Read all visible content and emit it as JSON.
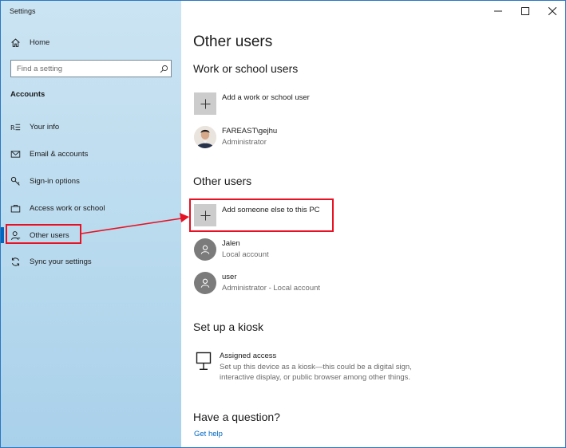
{
  "window": {
    "title": "Settings"
  },
  "sidebar": {
    "home_label": "Home",
    "search_placeholder": "Find a setting",
    "section_label": "Accounts",
    "items": [
      {
        "label": "Your info",
        "icon": "your-info-icon"
      },
      {
        "label": "Email & accounts",
        "icon": "email-icon"
      },
      {
        "label": "Sign-in options",
        "icon": "key-icon"
      },
      {
        "label": "Access work or school",
        "icon": "briefcase-icon"
      },
      {
        "label": "Other users",
        "icon": "person-icon",
        "selected": true
      },
      {
        "label": "Sync your settings",
        "icon": "sync-icon"
      }
    ]
  },
  "main": {
    "title": "Other users",
    "work_school": {
      "heading": "Work or school users",
      "add_label": "Add a work or school user",
      "user": {
        "name": "FAREAST\\gejhu",
        "role": "Administrator"
      }
    },
    "other_users": {
      "heading": "Other users",
      "add_label": "Add someone else to this PC",
      "users": [
        {
          "name": "Jalen",
          "role": "Local account"
        },
        {
          "name": "user",
          "role": "Administrator - Local account"
        }
      ]
    },
    "kiosk": {
      "heading": "Set up a kiosk",
      "title": "Assigned access",
      "desc_line1": "Set up this device as a kiosk—this could be a digital sign,",
      "desc_line2": "interactive display, or public browser among other things."
    },
    "question": {
      "heading": "Have a question?",
      "link": "Get help"
    }
  },
  "colors": {
    "accent": "#0067c0",
    "callout": "#e81123",
    "sidebar_bg": "#bcdcef"
  }
}
